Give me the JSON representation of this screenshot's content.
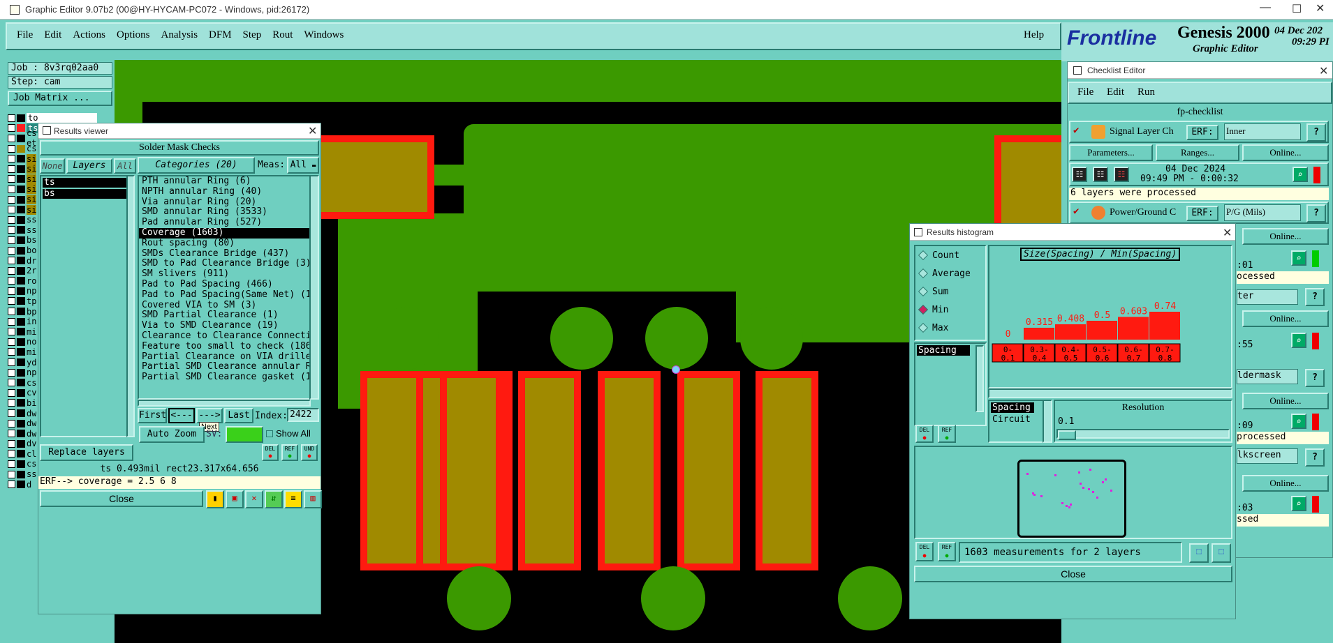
{
  "window": {
    "title": "Graphic Editor 9.07b2 (00@HY-HYCAM-PC072 - Windows, pid:26172)"
  },
  "menu": [
    "File",
    "Edit",
    "Actions",
    "Options",
    "Analysis",
    "DFM",
    "Step",
    "Rout",
    "Windows"
  ],
  "help_label": "Help",
  "brand": {
    "logo": "Frontline",
    "product": "Genesis 2000",
    "subtitle": "Graphic Editor",
    "date": "04 Dec 202",
    "time": "09:29 PI"
  },
  "left_panel": {
    "job": "Job : 8v3rq02aa0",
    "step": "Step: cam",
    "job_matrix": "Job Matrix ...",
    "layers": [
      "to",
      "ts",
      "cs etch",
      "cs",
      "si",
      "si",
      "si",
      "si",
      "si",
      "si",
      "ss",
      "ss",
      "bs",
      "bo",
      "dr",
      "2r",
      "ro",
      "np",
      "tp",
      "bp",
      "in",
      "mi",
      "no",
      "mi",
      "yd",
      "np",
      "cs",
      "cv",
      "bi",
      "dw",
      "dw",
      "dw",
      "dv",
      "cl",
      "cs",
      "ss",
      "d"
    ]
  },
  "results_viewer": {
    "title": "Results viewer",
    "header": "Solder Mask Checks",
    "none_btn": "None",
    "layers_btn": "Layers",
    "all_btn": "All",
    "layers": [
      "ts",
      "bs"
    ],
    "categories_btn": "Categories (20)",
    "meas_label": "Meas:",
    "meas_value": "All",
    "categories": [
      "PTH annular Ring (6)",
      "NPTH annular Ring (40)",
      "Via annular Ring (20)",
      "SMD annular Ring (3533)",
      "Pad annular Ring (527)",
      "Coverage (1603)",
      "Rout spacing (80)",
      "SMDs Clearance Bridge (437)",
      "SMD to Pad Clearance Bridge (3)",
      "SM slivers (911)",
      "Pad to Pad Spacing (466)",
      "Pad to Pad Spacing(Same Net) (10)",
      "Covered VIA to SM (3)",
      "SMD Partial Clearance (1)",
      "Via to SMD Clearance (19)",
      "Clearance to Clearance Connection",
      "Feature too small to check (186)",
      "Partial Clearance on VIA drilled",
      "Partial SMD Clearance annular Rin",
      "Partial SMD Clearance gasket (1)"
    ],
    "selected_index": 5,
    "first_btn": "First",
    "prev_btn": "<---",
    "next_btn": "--->",
    "last_btn": "Last",
    "index_label": "Index:",
    "index_value": "2422",
    "tooltip": "Next",
    "auto_zoom": "Auto Zoom",
    "sv_label": "SV:",
    "show_all": "Show All",
    "replace_layers": "Replace layers",
    "status": "ts 0.493mil  rect23.317x64.656",
    "erf": "ERF--> coverage = 2.5 6 8",
    "close": "Close",
    "del": "DEL",
    "ref": "REF",
    "und": "UND"
  },
  "checklist": {
    "title": "Checklist Editor",
    "menu": [
      "File",
      "Edit",
      "Run"
    ],
    "name": "fp-checklist",
    "row1_name": "Signal Layer Ch",
    "erf_label": "ERF:",
    "row1_erf": "Inner",
    "parameters": "Parameters...",
    "ranges": "Ranges...",
    "online": "Online...",
    "date": "04 Dec 2024",
    "time": "09:49 PM - 0:00:32",
    "processed": "6 layers were processed",
    "row2_name": "Power/Ground C",
    "row2_erf": "P/G (Mils)",
    "frag": [
      ":01",
      "ocessed",
      "ter",
      ":55",
      "ldermask",
      ":09",
      "processed",
      "lkscreen",
      ":03",
      "ssed"
    ],
    "help": "?"
  },
  "histogram": {
    "title": "Results histogram",
    "modes": [
      "Count",
      "Average",
      "Sum",
      "Min",
      "Max"
    ],
    "selected_mode": "Min",
    "chart_title": "Size(Spacing) / Min(Spacing)",
    "list": [
      "Spacing"
    ],
    "bins": [
      "0-\n0.1",
      "0.3-\n0.4",
      "0.4-\n0.5",
      "0.5-\n0.6",
      "0.6-\n0.7",
      "0.7-\n0.8"
    ],
    "types": [
      "Spacing",
      "Circuit"
    ],
    "resolution_label": "Resolution",
    "resolution_value": "0.1",
    "summary": "1603 measurements for 2 layers",
    "close": "Close",
    "del": "DEL",
    "ref": "REF"
  },
  "chart_data": {
    "type": "bar",
    "title": "Size(Spacing) / Min(Spacing)",
    "categories": [
      "0-0.1",
      "0.3-0.4",
      "0.4-0.5",
      "0.5-0.6",
      "0.6-0.7",
      "0.7-0.8"
    ],
    "values": [
      0,
      0.315,
      0.408,
      0.5,
      0.603,
      0.74
    ],
    "labels": [
      "0",
      "0.315",
      "0.408",
      "0.5",
      "0.603",
      "0.74"
    ],
    "colors": {
      "bar": "#ff1a10"
    }
  }
}
